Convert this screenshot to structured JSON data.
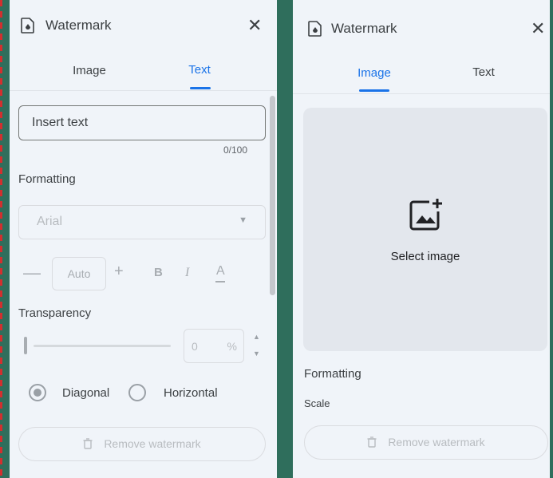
{
  "left_panel": {
    "title": "Watermark",
    "close_icon": "close-icon",
    "tabs": [
      {
        "label": "Image",
        "active": false
      },
      {
        "label": "Text",
        "active": true
      }
    ],
    "text_input": {
      "placeholder": "Insert text",
      "value": ""
    },
    "char_counter": "0/100",
    "formatting_label": "Formatting",
    "font_select": {
      "value": "Arial"
    },
    "font_size": {
      "value": "Auto",
      "decrease": "—",
      "increase": "+"
    },
    "style_buttons": {
      "bold": "B",
      "italic": "I",
      "text_color": "A"
    },
    "transparency_label": "Transparency",
    "transparency": {
      "value": "0",
      "unit": "%",
      "level": 0
    },
    "orientation": [
      {
        "label": "Diagonal",
        "checked": true
      },
      {
        "label": "Horizontal",
        "checked": false
      }
    ],
    "remove_button": "Remove watermark"
  },
  "right_panel": {
    "title": "Watermark",
    "close_icon": "close-icon",
    "tabs": [
      {
        "label": "Image",
        "active": true
      },
      {
        "label": "Text",
        "active": false
      }
    ],
    "select_image_label": "Select image",
    "formatting_label": "Formatting",
    "scale_label": "Scale",
    "remove_button": "Remove watermark"
  },
  "colors": {
    "accent": "#1a73e8",
    "panel_bg": "#f0f4f9",
    "slide_bg": "#2f6e5c",
    "disabled_text": "#b8bcc0"
  }
}
